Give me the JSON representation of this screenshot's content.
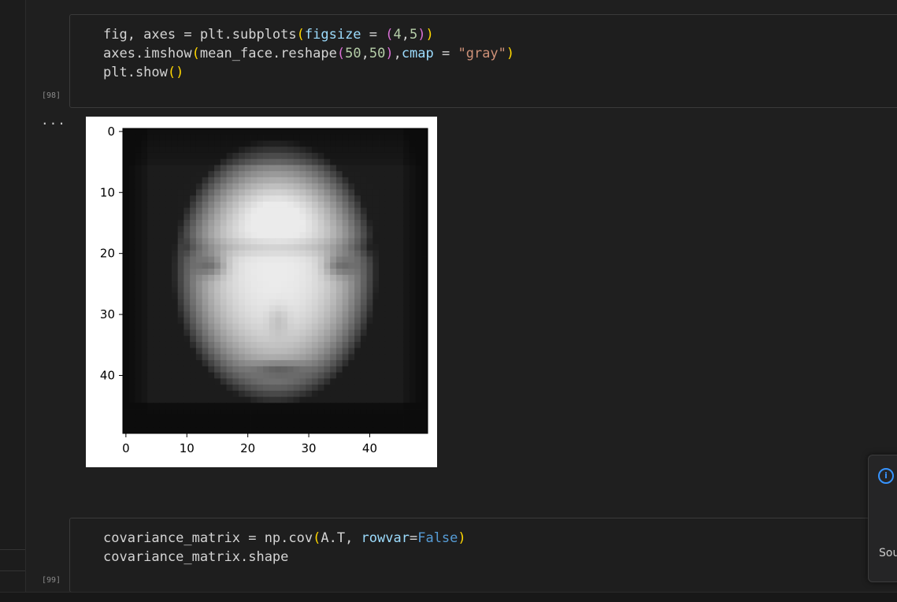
{
  "cells": [
    {
      "execution_count": "[98]",
      "lines": [
        [
          {
            "t": "fig, axes = plt.subplots",
            "c": "tok-fn"
          },
          {
            "t": "(",
            "c": "tok-b1"
          },
          {
            "t": "figsize",
            "c": "tok-param"
          },
          {
            "t": " = ",
            "c": "tok-fn"
          },
          {
            "t": "(",
            "c": "tok-b2"
          },
          {
            "t": "4",
            "c": "tok-num"
          },
          {
            "t": ",",
            "c": "tok-fn"
          },
          {
            "t": "5",
            "c": "tok-num"
          },
          {
            "t": ")",
            "c": "tok-b2"
          },
          {
            "t": ")",
            "c": "tok-b1"
          }
        ],
        [
          {
            "t": "axes.imshow",
            "c": "tok-fn"
          },
          {
            "t": "(",
            "c": "tok-b1"
          },
          {
            "t": "mean_face.reshape",
            "c": "tok-fn"
          },
          {
            "t": "(",
            "c": "tok-b2"
          },
          {
            "t": "50",
            "c": "tok-num"
          },
          {
            "t": ",",
            "c": "tok-fn"
          },
          {
            "t": "50",
            "c": "tok-num"
          },
          {
            "t": ")",
            "c": "tok-b2"
          },
          {
            "t": ",",
            "c": "tok-fn"
          },
          {
            "t": "cmap",
            "c": "tok-param"
          },
          {
            "t": " = ",
            "c": "tok-fn"
          },
          {
            "t": "\"gray\"",
            "c": "tok-str"
          },
          {
            "t": ")",
            "c": "tok-b1"
          }
        ],
        [
          {
            "t": "plt.show",
            "c": "tok-fn"
          },
          {
            "t": "()",
            "c": "tok-b1"
          }
        ]
      ]
    },
    {
      "execution_count": "[99]",
      "lines": [
        [
          {
            "t": "covariance_matrix = np.cov",
            "c": "tok-fn"
          },
          {
            "t": "(",
            "c": "tok-b1"
          },
          {
            "t": "A.T, ",
            "c": "tok-fn"
          },
          {
            "t": "rowvar",
            "c": "tok-param"
          },
          {
            "t": "=",
            "c": "tok-fn"
          },
          {
            "t": "False",
            "c": "tok-kw"
          },
          {
            "t": ")",
            "c": "tok-b1"
          }
        ],
        [
          {
            "t": "covariance_matrix.shape",
            "c": "tok-fn"
          }
        ]
      ]
    }
  ],
  "output_ellipsis": "...",
  "toast": {
    "icon": "info-icon",
    "text": "Sou"
  },
  "chart_data": {
    "type": "heatmap",
    "description_colormap": "gray",
    "shape": [
      50,
      50
    ],
    "xlim": [
      -0.5,
      49.5
    ],
    "ylim": [
      49.5,
      -0.5
    ],
    "xticks": [
      0,
      10,
      20,
      30,
      40
    ],
    "yticks": [
      0,
      10,
      20,
      30,
      40
    ],
    "title": "",
    "xlabel": "",
    "ylabel": ""
  }
}
